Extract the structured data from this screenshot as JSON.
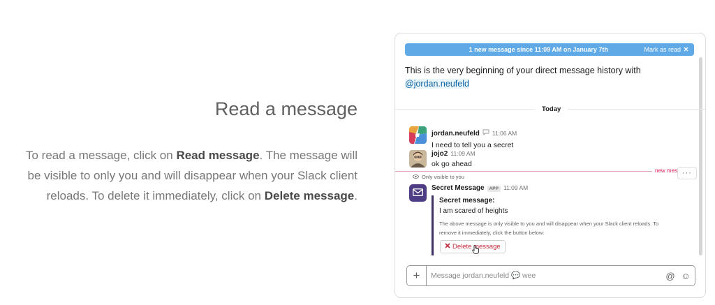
{
  "tutorial": {
    "title": "Read a message",
    "desc_part1": "To read a message, click on ",
    "desc_bold1": "Read message",
    "desc_part2": ". The message will be visible to only you and will disappear when your Slack client reloads. To delete it immediately, click on ",
    "desc_bold2": "Delete message",
    "desc_part3": "."
  },
  "banner": {
    "text": "1 new message since 11:09 AM on January 7th",
    "mark_as_read": "Mark as read",
    "close_icon": "close-icon",
    "color": "#5fa9e6"
  },
  "intro": {
    "text": "This is the very beginning of your direct message history with",
    "mention": "@jordan.neufeld"
  },
  "divider": {
    "label": "Today"
  },
  "messages": [
    {
      "author": "jordan.neufeld",
      "status_icon": "speech-bubble-icon",
      "time": "11:06 AM",
      "text": "I need to tell you a secret"
    },
    {
      "author": "jojo2",
      "time": "11:09 AM",
      "text": "ok go ahead"
    }
  ],
  "new_marker": {
    "label": "new mes",
    "more_label": "···"
  },
  "app_message": {
    "only_visible": "Only visible to you",
    "author": "Secret Message",
    "badge": "APP",
    "time": "11:09 AM",
    "accent": "#3d2e63",
    "attachment": {
      "title": "Secret message:",
      "text": "I am scared of heights",
      "note": "The above message is only visible to you and will disappear when your Slack client reloads. To remove it immediately, click the button below:",
      "delete_label": "Delete message"
    }
  },
  "composer": {
    "plus": "+",
    "placeholder": "Message jordan.neufeld 💬 wee",
    "at_icon": "@",
    "emoji_icon": "☺"
  }
}
